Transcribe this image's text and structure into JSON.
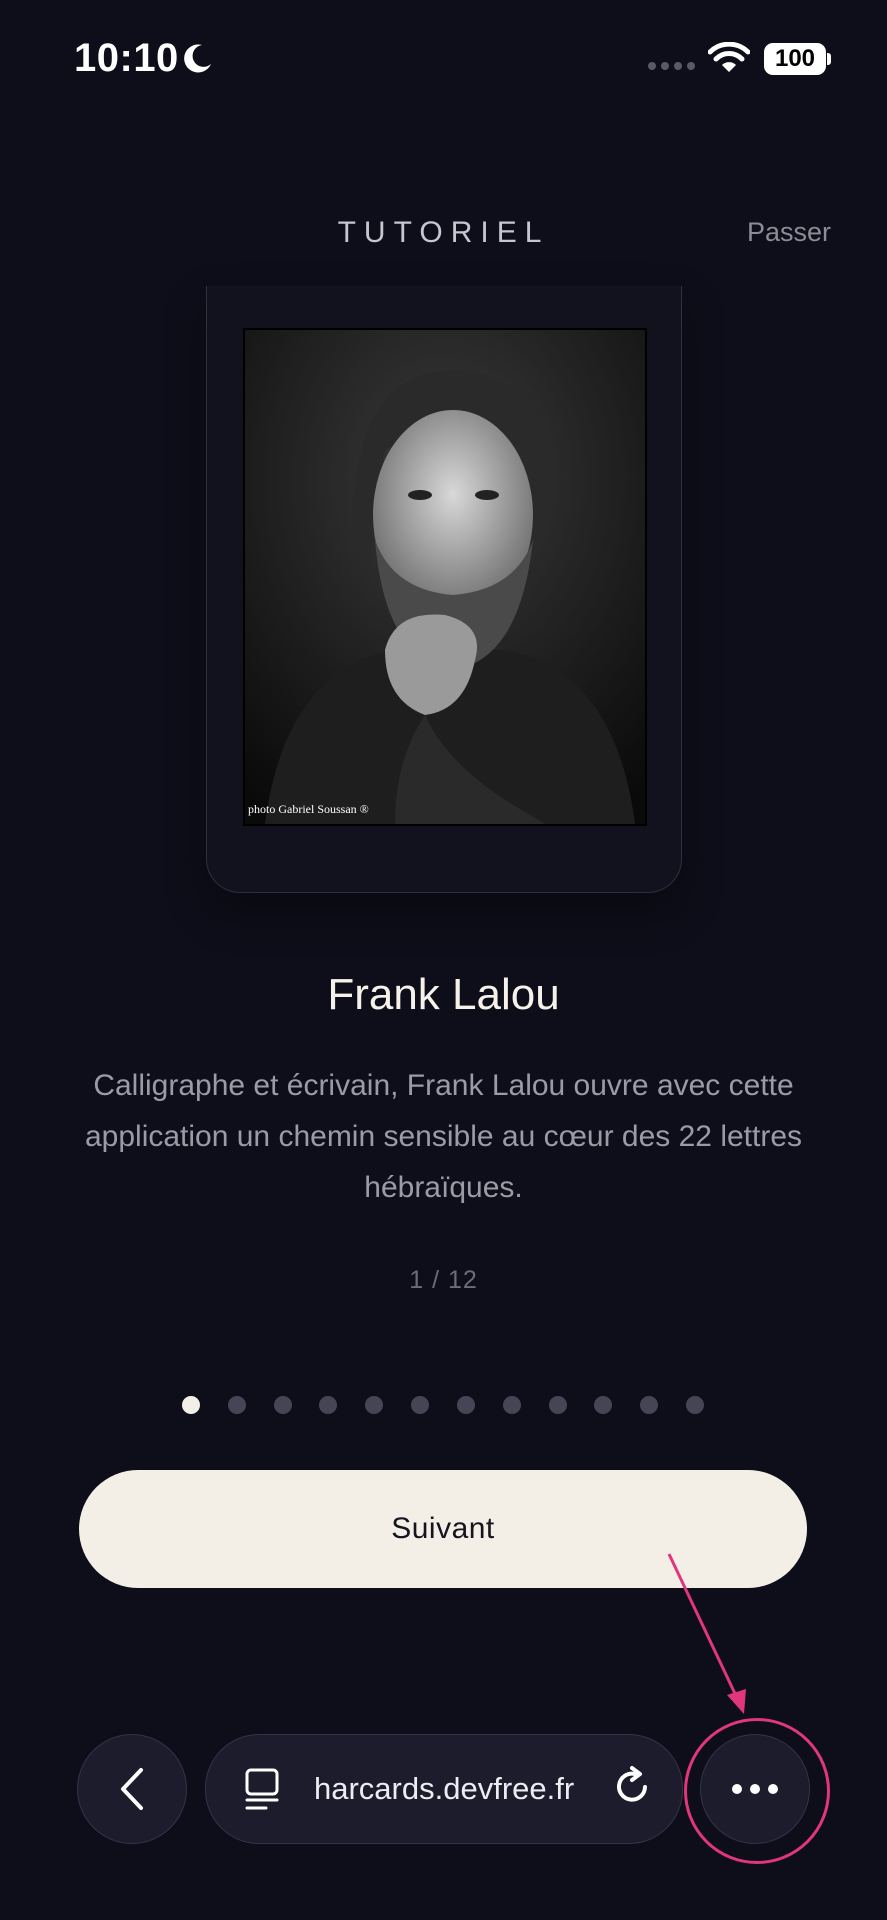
{
  "status_bar": {
    "time": "10:10",
    "battery": "100"
  },
  "header": {
    "title": "TUTORIEL",
    "skip_label": "Passer"
  },
  "card": {
    "photo_credit": "photo Gabriel Soussan ®"
  },
  "content": {
    "name": "Frank Lalou",
    "description": "Calligraphe et écrivain, Frank Lalou ouvre avec cette application un chemin sensible au cœur des 22 lettres hébraïques.",
    "page_counter": "1 / 12"
  },
  "pagination": {
    "total": 12,
    "current": 1
  },
  "next_label": "Suivant",
  "browser": {
    "url": "harcards.devfree.fr"
  },
  "colors": {
    "background": "#0e0e1a",
    "button": "#f4efe6",
    "annotation": "#e0367c"
  }
}
